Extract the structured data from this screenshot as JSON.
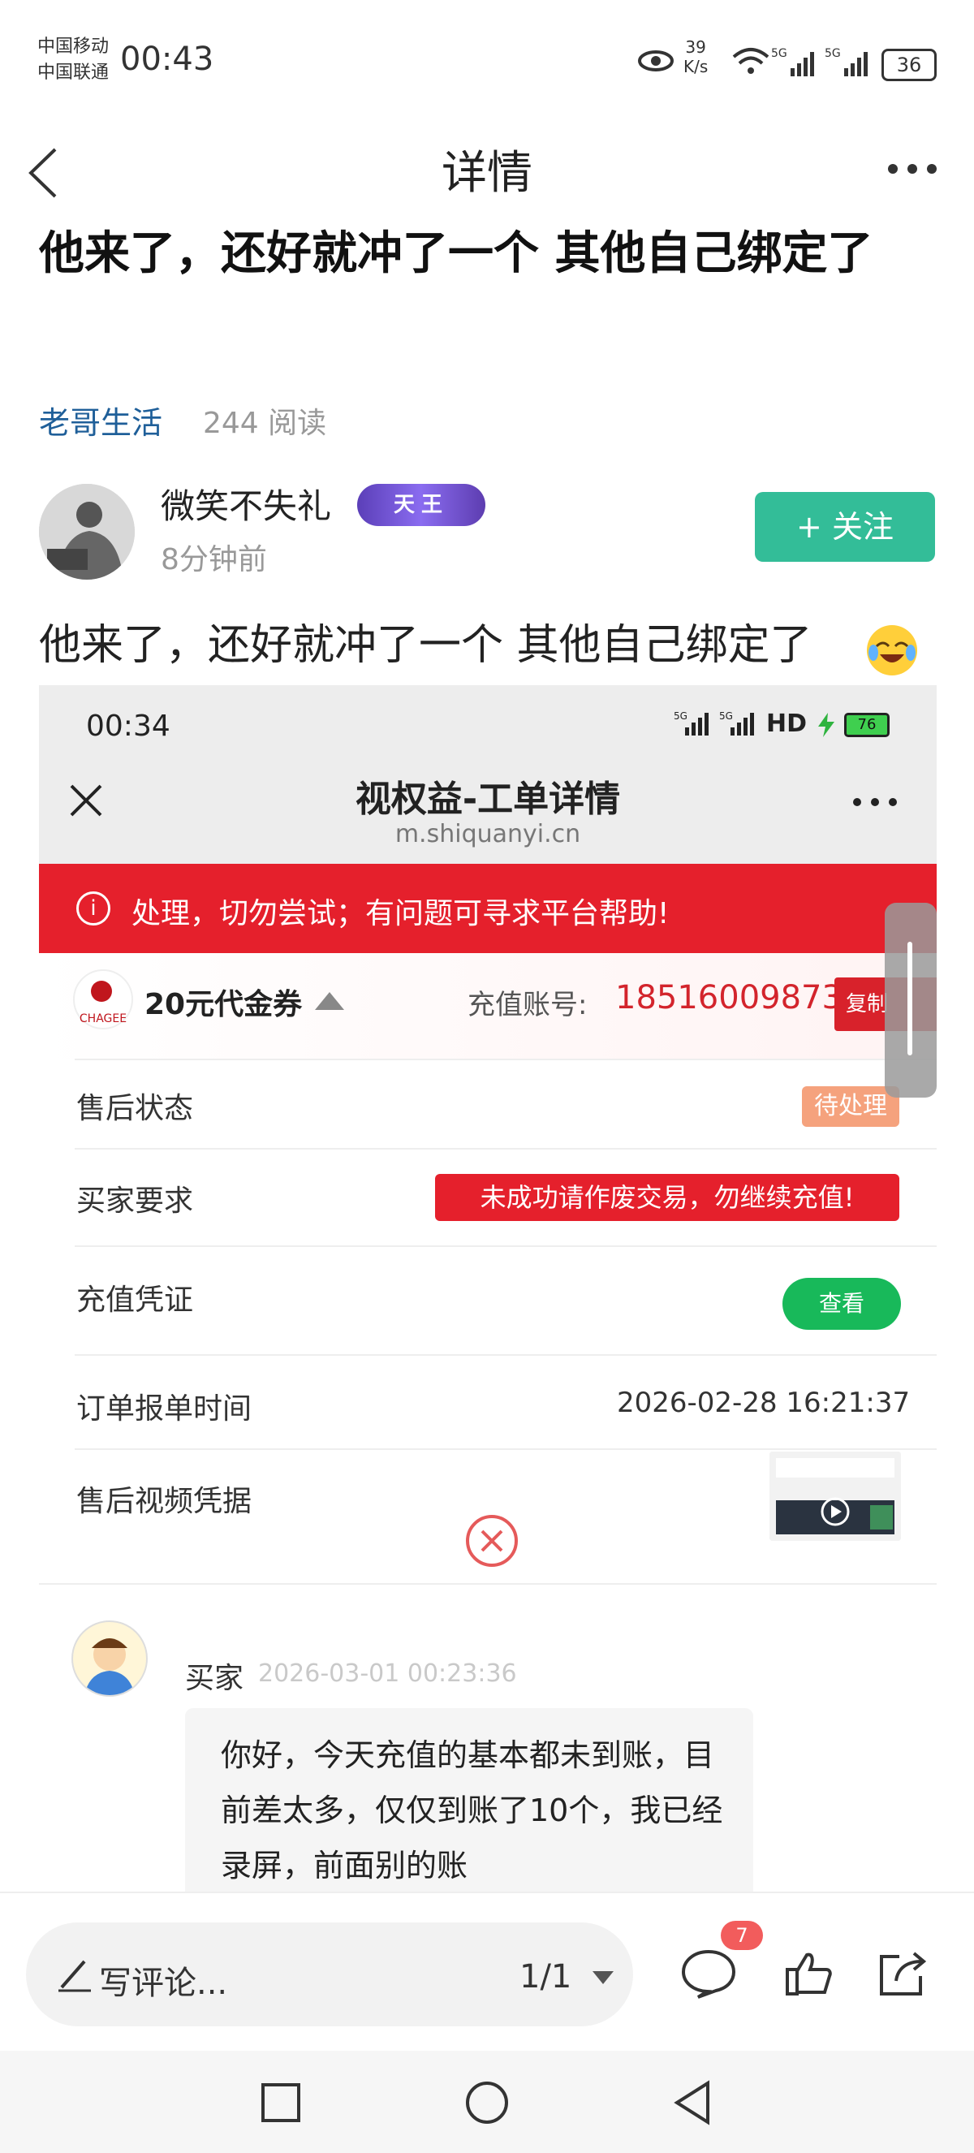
{
  "status_bar": {
    "carrier_1": "中国移动",
    "carrier_2": "中国联通",
    "time": "00:43",
    "net_speed_value": "39",
    "net_speed_unit": "K/s",
    "battery": "36"
  },
  "nav": {
    "title": "详情"
  },
  "post": {
    "headline": "他来了，还好就冲了一个 其他自己绑定了",
    "topic": "老哥生活",
    "reads": "244 阅读",
    "author": "微笑不失礼",
    "badge": "天王",
    "time_ago": "8分钟前",
    "follow_label": "+ 关注",
    "body": "他来了，还好就冲了一个 其他自己绑定了"
  },
  "screenshot": {
    "time": "00:34",
    "battery": "76",
    "network": "HD",
    "title": "视权益-工单详情",
    "url": "m.shiquanyi.cn",
    "notice": "处理，切勿尝试；有问题可寻求平台帮助!",
    "product": "20元代金券",
    "logo_text": "CHAGEE",
    "account_label": "充值账号:",
    "account": "18516009873",
    "copy_label": "复制",
    "rows": [
      {
        "label": "售后状态",
        "value": "待处理"
      },
      {
        "label": "买家要求",
        "value": "未成功请作废交易，勿继续充值!"
      },
      {
        "label": "充值凭证",
        "value": "查看"
      },
      {
        "label": "订单报单时间",
        "value": "2026-02-28 16:21:37"
      },
      {
        "label": "售后视频凭据",
        "value": ""
      }
    ],
    "buyer": "买家",
    "buyer_time": "2026-03-01 00:23:36",
    "message": "你好，今天充值的基本都未到账，目前差太多，仅仅到账了10个，我已经录屏，前面别的账"
  },
  "bottom": {
    "comment_placeholder": "写评论...",
    "page_indicator": "1/1",
    "comment_count": "7"
  },
  "colors": {
    "accent_green": "#33bd98",
    "topic_blue": "#1f5f99",
    "alert_red": "#e5202c"
  }
}
